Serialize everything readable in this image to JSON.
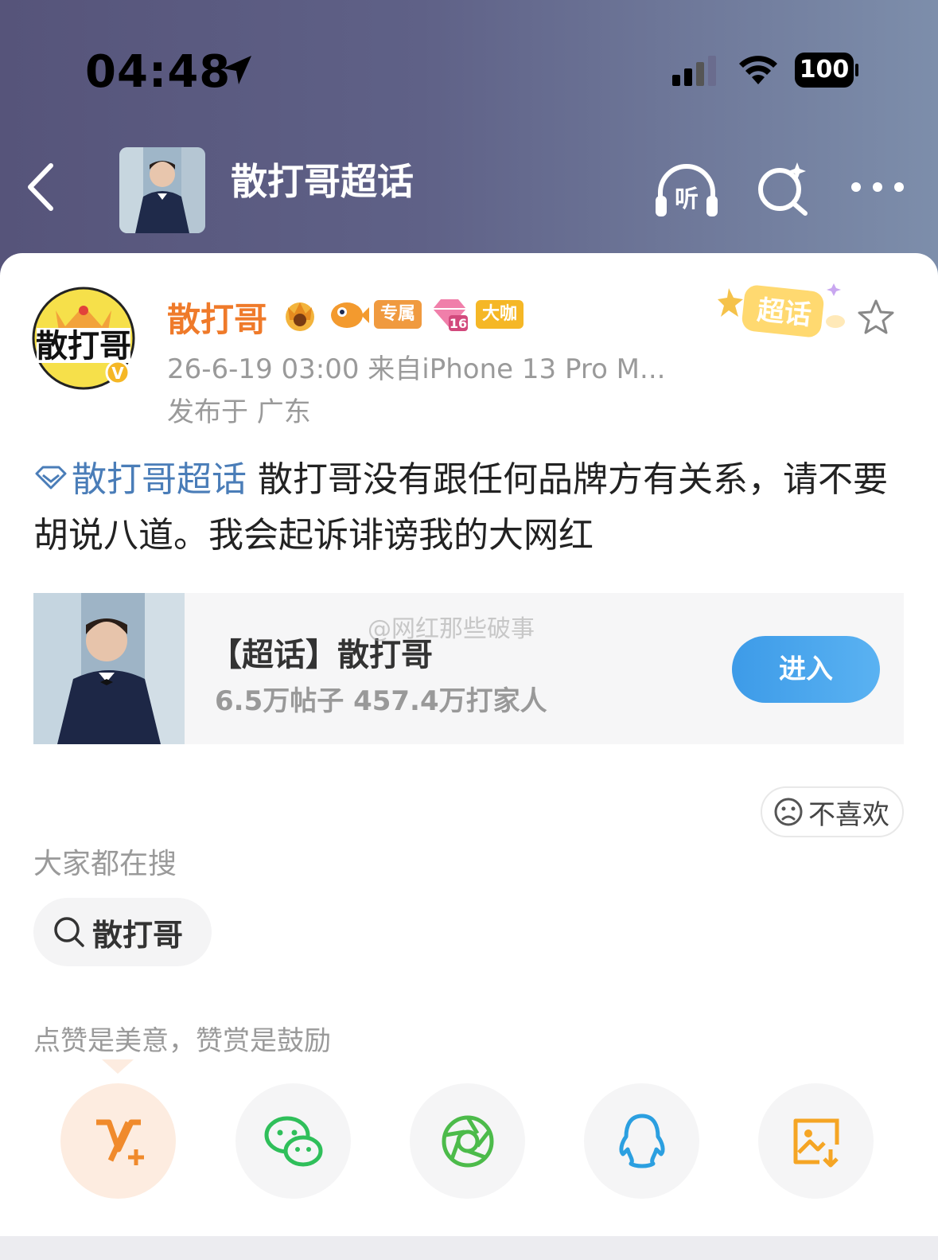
{
  "status_bar": {
    "time": "04:48",
    "battery": "100"
  },
  "nav": {
    "title": "散打哥超话",
    "listen_label": "听"
  },
  "post": {
    "author": "散打哥",
    "tags": [
      "专属",
      "大咖"
    ],
    "level_badge": "16",
    "meta": "26-6-19 03:00  来自iPhone 13 Pro M...",
    "location": "发布于 广东",
    "supertopic_badge": "超话",
    "topic_link": "散打哥超话",
    "body": " 散打哥没有跟任何品牌方有关系，请不要胡说八道。我会起诉诽谤我的大网红"
  },
  "topic_card": {
    "title": "【超话】散打哥",
    "stats": "6.5万帖子 457.4万打家人",
    "watermark": "@网红那些破事",
    "enter_label": "进入"
  },
  "dislike_label": "不喜欢",
  "search": {
    "heading": "大家都在搜",
    "chip": "散打哥"
  },
  "reward_text": "点赞是美意，赞赏是鼓励",
  "share": {
    "items": [
      "vip-icon",
      "wechat-icon",
      "moments-icon",
      "qq-icon",
      "save-image-icon"
    ]
  },
  "colors": {
    "author_orange": "#ef7a2a",
    "topic_blue": "#4a7db8",
    "enter_blue": "#4aa6ee",
    "header_gradient": [
      "#56547a",
      "#7d8eab"
    ]
  }
}
